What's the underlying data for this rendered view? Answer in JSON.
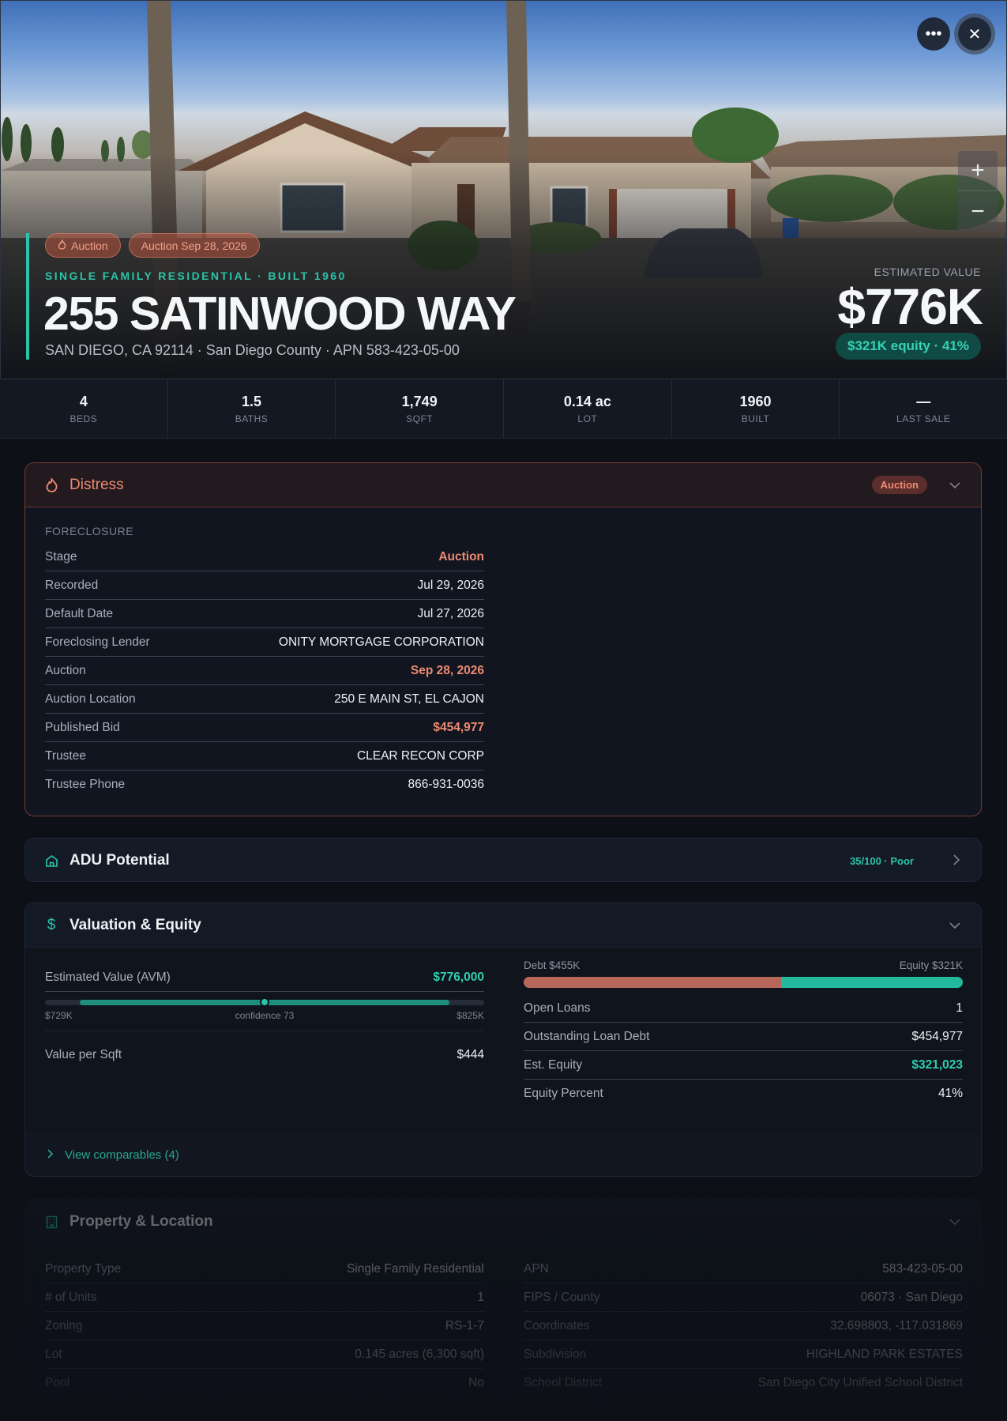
{
  "hero": {
    "chips": [
      {
        "label": "Auction",
        "icon": "flame-icon"
      },
      {
        "label": "Auction Sep 28, 2026"
      }
    ],
    "subtitle": "SINGLE FAMILY RESIDENTIAL · BUILT 1960",
    "title": "255 SATINWOOD WAY",
    "address": "SAN DIEGO, CA 92114 · San Diego County · APN 583-423-05-00",
    "est_label": "ESTIMATED VALUE",
    "est_value": "$776K",
    "equity_pill": "$321K equity · 41%",
    "more_icon": "more-horizontal-icon",
    "close_icon": "close-icon",
    "zoom_in": "+",
    "zoom_out": "−"
  },
  "stats": [
    {
      "value": "4",
      "label": "BEDS"
    },
    {
      "value": "1.5",
      "label": "BATHS"
    },
    {
      "value": "1,749",
      "label": "SQFT"
    },
    {
      "value": "0.14 ac",
      "label": "LOT"
    },
    {
      "value": "1960",
      "label": "BUILT"
    },
    {
      "value": "—",
      "label": "LAST SALE"
    }
  ],
  "distress": {
    "title": "Distress",
    "badge": "Auction",
    "section": "FORECLOSURE",
    "rows": [
      {
        "k": "Stage",
        "v": "Auction",
        "tone": "orange"
      },
      {
        "k": "Recorded",
        "v": "Jul 29, 2026",
        "tone": ""
      },
      {
        "k": "Default Date",
        "v": "Jul 27, 2026",
        "tone": ""
      },
      {
        "k": "Foreclosing Lender",
        "v": "ONITY MORTGAGE CORPORATION",
        "tone": ""
      },
      {
        "k": "Auction",
        "v": "Sep 28, 2026",
        "tone": "orange"
      },
      {
        "k": "Auction Location",
        "v": "250 E MAIN ST, EL CAJON",
        "tone": ""
      },
      {
        "k": "Published Bid",
        "v": "$454,977",
        "tone": "orange"
      },
      {
        "k": "Trustee",
        "v": "CLEAR RECON CORP",
        "tone": ""
      },
      {
        "k": "Trustee Phone",
        "v": "866-931-0036",
        "tone": ""
      }
    ]
  },
  "adu": {
    "title": "ADU Potential",
    "badge": "35/100 · Poor"
  },
  "valuation": {
    "title": "Valuation & Equity",
    "avm_label": "Estimated Value (AVM)",
    "avm_value": "$776,000",
    "range_low": "$729K",
    "confidence": "confidence 73",
    "range_high": "$825K",
    "vps_label": "Value per Sqft",
    "vps_value": "$444",
    "debt_label": "Debt $455K",
    "equity_label": "Equity $321K",
    "debt_fraction": 0.586,
    "rows": [
      {
        "k": "Open Loans",
        "v": "1",
        "tone": ""
      },
      {
        "k": "Outstanding Loan Debt",
        "v": "$454,977",
        "tone": ""
      },
      {
        "k": "Est. Equity",
        "v": "$321,023",
        "tone": "green"
      },
      {
        "k": "Equity Percent",
        "v": "41%",
        "tone": ""
      }
    ],
    "comparables": "View comparables (4)"
  },
  "property": {
    "title": "Property & Location",
    "left": [
      {
        "k": "Property Type",
        "v": "Single Family Residential"
      },
      {
        "k": "# of Units",
        "v": "1"
      },
      {
        "k": "Zoning",
        "v": "RS-1-7"
      },
      {
        "k": "Lot",
        "v": "0.145 acres (6,300 sqft)"
      },
      {
        "k": "Pool",
        "v": "No"
      }
    ],
    "right": [
      {
        "k": "APN",
        "v": "583-423-05-00"
      },
      {
        "k": "FIPS / County",
        "v": "06073 · San Diego"
      },
      {
        "k": "Coordinates",
        "v": "32.698803, -117.031869"
      },
      {
        "k": "Subdivision",
        "v": "HIGHLAND PARK ESTATES"
      },
      {
        "k": "School District",
        "v": "San Diego City Unified School District"
      }
    ]
  },
  "colors": {
    "accent": "#2bc4a8",
    "distress": "#ef8a72",
    "background": "#0d1017"
  }
}
